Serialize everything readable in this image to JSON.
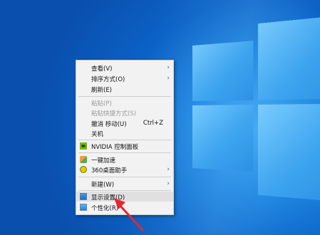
{
  "context_menu": {
    "items": [
      {
        "label": "查看(V)",
        "submenu": true
      },
      {
        "label": "排序方式(O)",
        "submenu": true
      },
      {
        "label": "刷新(E)"
      },
      {
        "label": "粘贴(P)",
        "disabled": true
      },
      {
        "label": "粘贴快捷方式(S)",
        "disabled": true
      },
      {
        "label": "撤消 移动(U)",
        "shortcut": "Ctrl+Z"
      },
      {
        "label": "关机"
      },
      {
        "label": "NVIDIA 控制面板",
        "icon": "nvidia-icon"
      },
      {
        "label": "一键加速",
        "icon": "speedup-icon"
      },
      {
        "label": "360桌面助手",
        "icon": "assistant-360-icon",
        "submenu": true
      },
      {
        "label": "新建(W)",
        "submenu": true
      },
      {
        "label": "显示设置(D)",
        "icon": "display-settings-icon",
        "highlighted": true
      },
      {
        "label": "个性化(R)",
        "icon": "personalize-icon"
      }
    ],
    "submenu_arrow": "›"
  },
  "colors": {
    "annotation_arrow": "#e6262e",
    "menu_background": "#f2f2f2",
    "desktop_blue": "#0b62c6"
  }
}
